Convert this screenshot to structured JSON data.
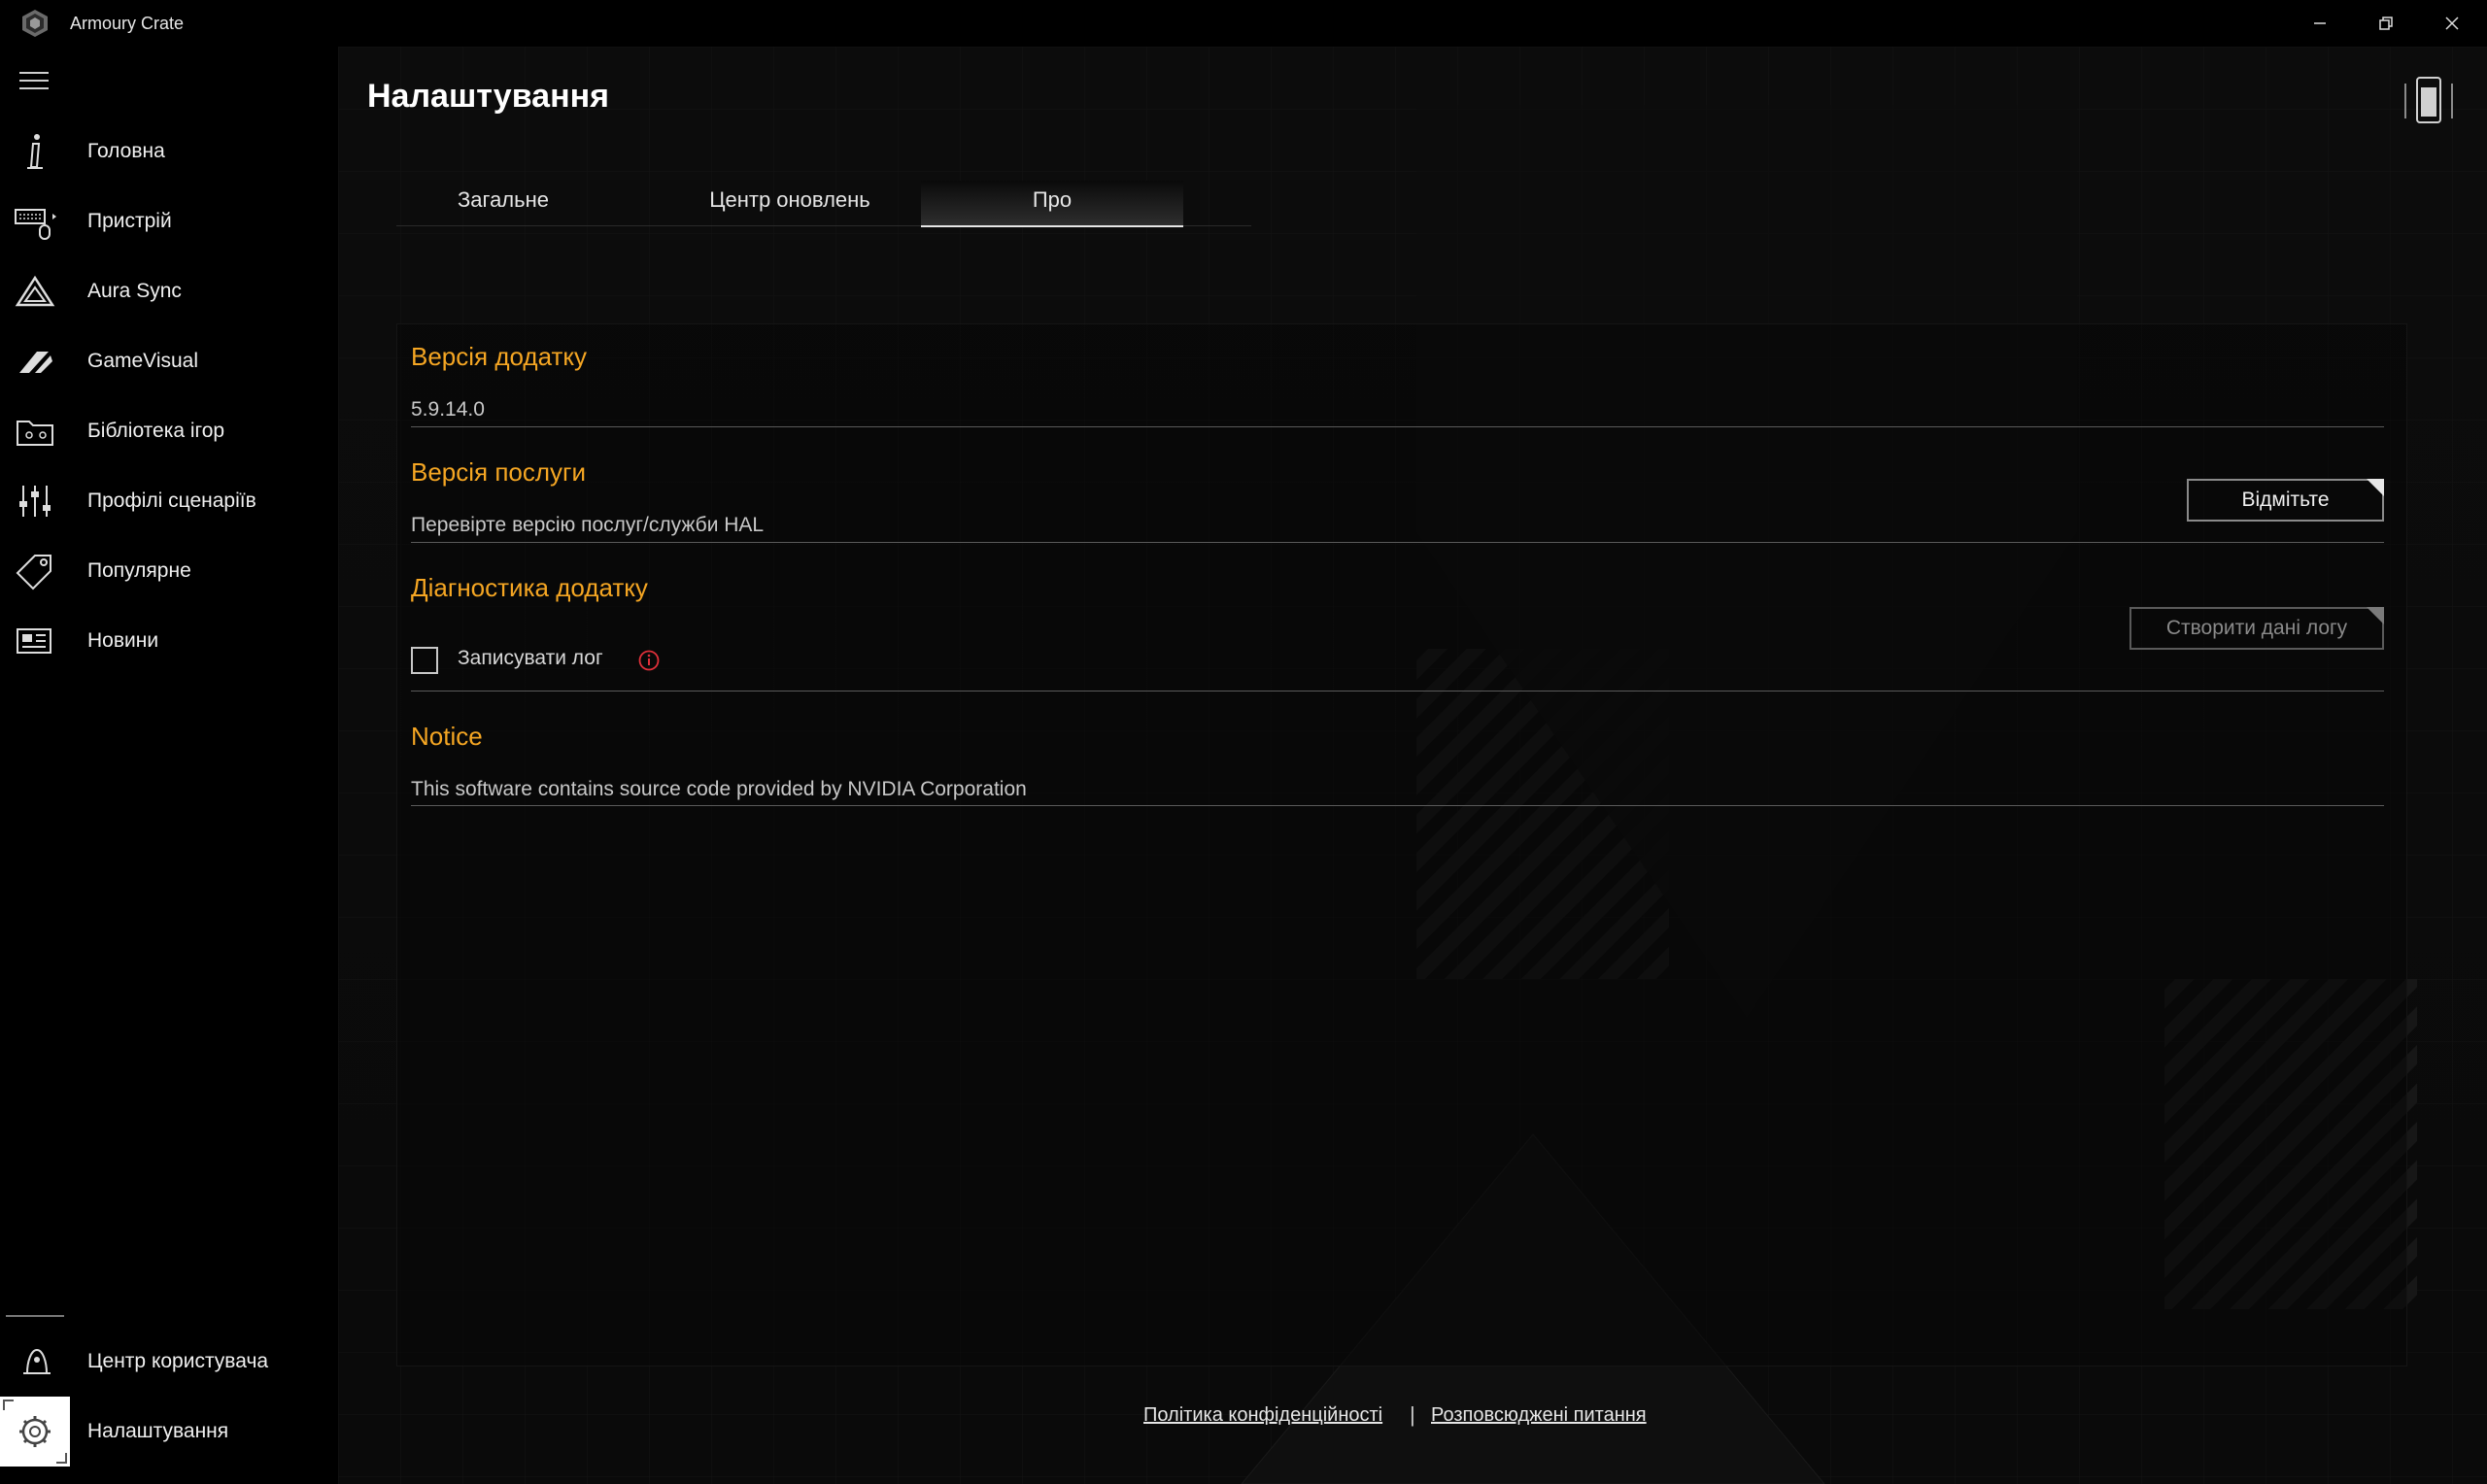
{
  "window": {
    "title": "Armoury Crate",
    "minimize_label": "–",
    "restore_label": "❐",
    "close_label": "✕"
  },
  "sidebar": {
    "items": [
      {
        "label": "Головна",
        "icon": "home-info-icon"
      },
      {
        "label": "Пристрій",
        "icon": "keyboard-mouse-icon"
      },
      {
        "label": "Aura Sync",
        "icon": "aura-triangle-icon"
      },
      {
        "label": "GameVisual",
        "icon": "gamevisual-icon"
      },
      {
        "label": "Бібліотека ігор",
        "icon": "game-library-icon"
      },
      {
        "label": "Профілі сценаріїв",
        "icon": "sliders-icon"
      },
      {
        "label": "Популярне",
        "icon": "tag-icon"
      },
      {
        "label": "Новини",
        "icon": "news-icon"
      }
    ],
    "bottom": [
      {
        "label": "Центр користувача",
        "icon": "user-center-icon"
      },
      {
        "label": "Налаштування",
        "icon": "gear-icon"
      }
    ]
  },
  "main": {
    "page_title": "Налаштування",
    "tabs": [
      {
        "label": "Загальне",
        "active": false
      },
      {
        "label": "Центр оновлень",
        "active": false
      },
      {
        "label": "Про",
        "active": true
      }
    ],
    "sections": {
      "app_version": {
        "title": "Версія додатку",
        "value": "5.9.14.0"
      },
      "service_version": {
        "title": "Версія послуги",
        "value": "Перевірте версію послуг/служби HAL",
        "button": "Відмітьте"
      },
      "diagnostics": {
        "title": "Діагностика додатку",
        "checkbox_label": "Записувати лог",
        "checkbox_checked": false,
        "button": "Створити дані логу"
      },
      "notice": {
        "title": "Notice",
        "value": "This software contains source code provided by NVIDIA Corporation"
      }
    },
    "footer": {
      "privacy_link": "Політика конфіденційності",
      "separator": "|",
      "faq_link": "Розповсюджені питання"
    }
  },
  "colors": {
    "accent": "#f5a623",
    "background": "#000000",
    "text": "#e6e6e6"
  }
}
